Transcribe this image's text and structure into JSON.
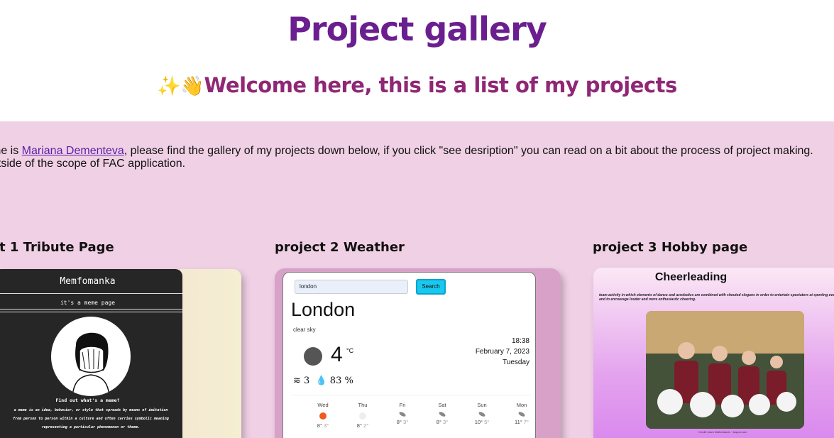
{
  "header": {
    "title": "Project gallery",
    "welcome_emoji": "✨👋",
    "welcome": "Welcome here, this is a list of my projects"
  },
  "intro": {
    "prefix": "me is ",
    "name_link": "Mariana Dementeva",
    "line1_rest": ", please find the gallery of my projects down below, if you click \"see desription\" you can read on a bit about the process of project making.",
    "line2": "utside of the scope of FAC application."
  },
  "projects": [
    {
      "title": "t 1 Tribute Page",
      "preview": {
        "site_title": "Memfomanka",
        "subtitle": "it's a meme page",
        "question": "Find out what's a meme?",
        "paragraph": "a meme is an idea, behavior, or style that spreads by means of imitation from person to person within a culture and often carries symbolic meaning representing a particular phenomenon or theme."
      }
    },
    {
      "title": "project 2 Weather",
      "preview": {
        "search_value": "london",
        "search_button": "Search",
        "city": "London",
        "description": "clear sky",
        "temperature": "4",
        "unit": "°C",
        "time": "18:38",
        "date": "February 7, 2023",
        "weekday": "Tuesday",
        "wind": "3",
        "humidity": "83 %",
        "forecast": [
          {
            "day": "Wed",
            "hi": "8°",
            "lo": "3°",
            "icon": "sun-icon"
          },
          {
            "day": "Thu",
            "hi": "8°",
            "lo": "2°",
            "icon": "cloud-icon"
          },
          {
            "day": "Fri",
            "hi": "8°",
            "lo": "3°",
            "icon": "rain-icon"
          },
          {
            "day": "Sat",
            "hi": "8°",
            "lo": "3°",
            "icon": "rain-icon"
          },
          {
            "day": "Sun",
            "hi": "10°",
            "lo": "5°",
            "icon": "rain-icon"
          },
          {
            "day": "Mon",
            "hi": "11°",
            "lo": "7°",
            "icon": "rain-icon"
          }
        ]
      }
    },
    {
      "title": "project 3 Hobby page",
      "preview": {
        "site_title": "Cheerleading",
        "text": "team activity in which elements of dance and acrobatics are combined with shouted slogans in order to entertain spectators at sporting events and to encourage louder and more enthusiastic cheering.",
        "credit": "Credit: team Netherlands · Jasper.com"
      }
    }
  ],
  "colors": {
    "title": "#6b1f8f",
    "welcome": "#8f2775",
    "section_bg": "#f0d0e5",
    "link": "#5a1fa8"
  }
}
